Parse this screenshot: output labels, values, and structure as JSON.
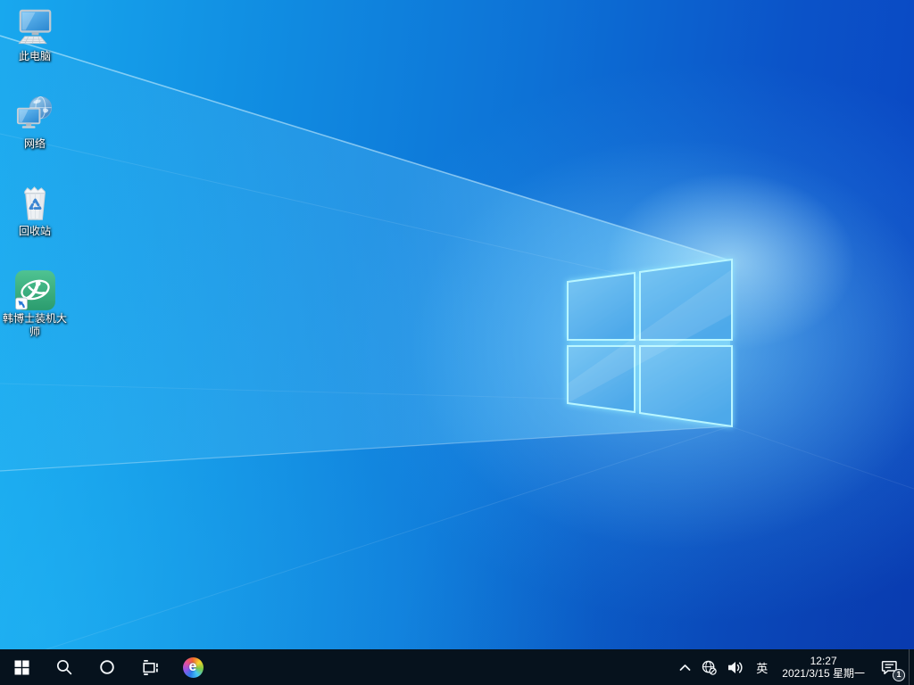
{
  "wallpaper": {
    "style": "windows10-light-rays",
    "base_left_color": "#14a3ea",
    "base_right_color": "#0a45c2",
    "logo_fill": "#5fb4ec",
    "logo_edge_glow": "#b6f3ff"
  },
  "desktop": {
    "icons": [
      {
        "id": "this-pc",
        "label": "此电脑"
      },
      {
        "id": "network",
        "label": "网络"
      },
      {
        "id": "recycle-bin",
        "label": "回收站"
      },
      {
        "id": "hanboshi-installer",
        "label": "韩博士装机大师"
      }
    ]
  },
  "taskbar": {
    "background_color": "#06121d",
    "buttons": [
      {
        "id": "start",
        "icon": "windows-logo-icon"
      },
      {
        "id": "search",
        "icon": "search-icon"
      },
      {
        "id": "cortana",
        "icon": "cortana-circle-icon"
      },
      {
        "id": "task-view",
        "icon": "task-view-icon"
      },
      {
        "id": "edge",
        "icon": "edge-browser-icon"
      }
    ],
    "edge_glyph": "e",
    "tray": {
      "hidden_icons": "chevron-up-icon",
      "network_status": "globe-offline-icon",
      "volume": "speaker-icon",
      "language": "英",
      "time": "12:27",
      "date": "2021/3/15 星期一",
      "notification_count": "1"
    }
  }
}
